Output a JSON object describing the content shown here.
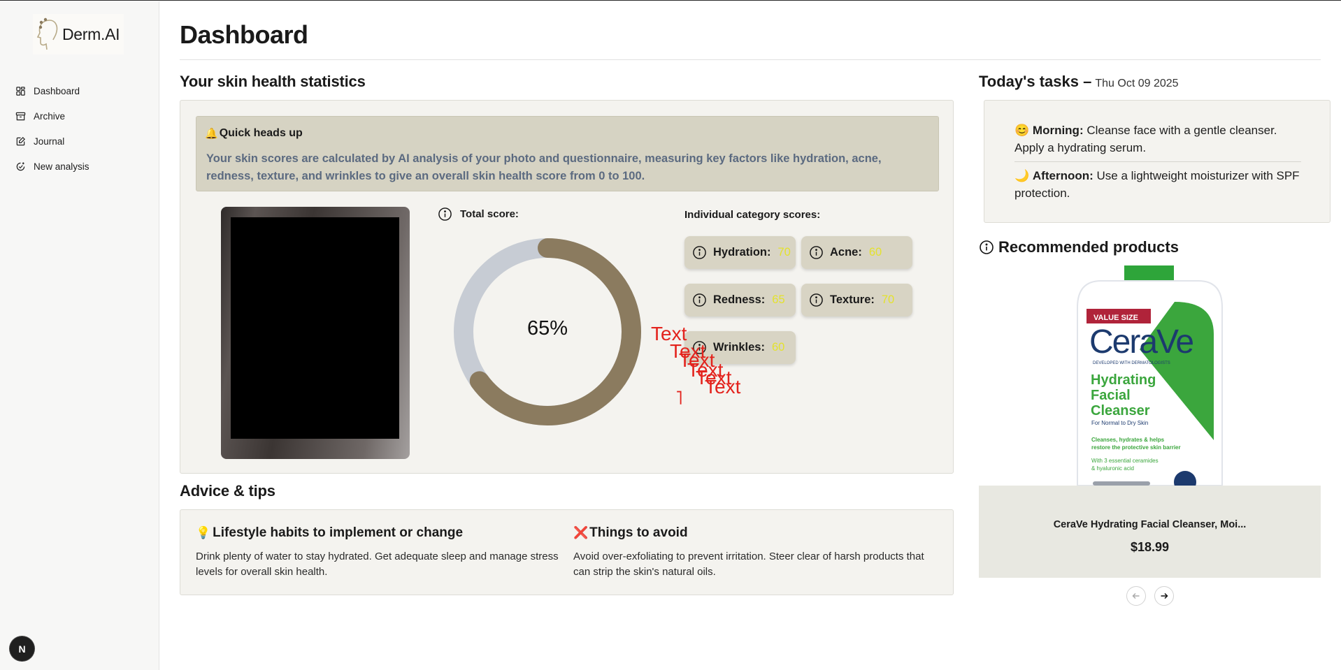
{
  "app": {
    "name": "Derm.AI"
  },
  "sidebar": {
    "items": [
      {
        "label": "Dashboard",
        "icon": "dashboard-icon"
      },
      {
        "label": "Archive",
        "icon": "archive-icon"
      },
      {
        "label": "Journal",
        "icon": "journal-icon"
      },
      {
        "label": "New analysis",
        "icon": "new-analysis-icon"
      }
    ],
    "avatar_letter": "N"
  },
  "header": {
    "title": "Dashboard"
  },
  "stats": {
    "heading": "Your skin health statistics",
    "headsup": {
      "emoji": "🔔",
      "title": "Quick heads up",
      "text": "Your skin scores are calculated by AI analysis of your photo and questionnaire, measuring key factors like hydration, acne, redness, texture, and wrinkles to give an overall skin health score from 0 to 100."
    },
    "total_label": "Total score:",
    "total_score": 65,
    "total_display": "65%",
    "category_label": "Individual category scores:",
    "categories": [
      {
        "label": "Hydration:",
        "value": "70"
      },
      {
        "label": "Acne:",
        "value": "60"
      },
      {
        "label": "Redness:",
        "value": "65"
      },
      {
        "label": "Texture:",
        "value": "70"
      },
      {
        "label": "Wrinkles:",
        "value": "60"
      }
    ],
    "overlay_texts": [
      "Text",
      "Text",
      "Text",
      "Text",
      "Text",
      "Text"
    ],
    "overlay_mark": "˥"
  },
  "colors": {
    "donut_fill": "#8b7b5f",
    "donut_track": "#c7ccd4",
    "score_value": "#e4e22d"
  },
  "advice": {
    "heading": "Advice & tips",
    "lifestyle": {
      "emoji": "💡",
      "title": "Lifestyle habits to implement or change",
      "text": "Drink plenty of water to stay hydrated. Get adequate sleep and manage stress levels for overall skin health."
    },
    "avoid": {
      "emoji": "❌",
      "title": "Things to avoid",
      "text": "Avoid over-exfoliating to prevent irritation. Steer clear of harsh products that can strip the skin's natural oils."
    }
  },
  "tasks": {
    "heading": "Today's tasks –",
    "date": "Thu Oct 09 2025",
    "morning": {
      "emoji": "😊",
      "label": "Morning:",
      "text": "Cleanse face with a gentle cleanser. Apply a hydrating serum."
    },
    "afternoon": {
      "emoji": "🌙",
      "label": "Afternoon:",
      "text": "Use a lightweight moisturizer with SPF protection."
    }
  },
  "recommended": {
    "heading": "Recommended products",
    "product": {
      "name": "CeraVe Hydrating Facial Cleanser, Moi...",
      "price": "$18.99",
      "packaging": {
        "badge": "VALUE SIZE",
        "brand": "CeraVe",
        "tagline": "DEVELOPED WITH DERMATOLOGISTS",
        "title_lines": [
          "Hydrating",
          "Facial",
          "Cleanser"
        ],
        "subtitle": "For Normal to Dry Skin",
        "claim_lines": [
          "Cleanses, hydrates & helps",
          "restore the protective skin barrier"
        ],
        "ingredient_lines": [
          "With 3 essential ceramides",
          "& hyaluronic acid"
        ]
      }
    }
  }
}
